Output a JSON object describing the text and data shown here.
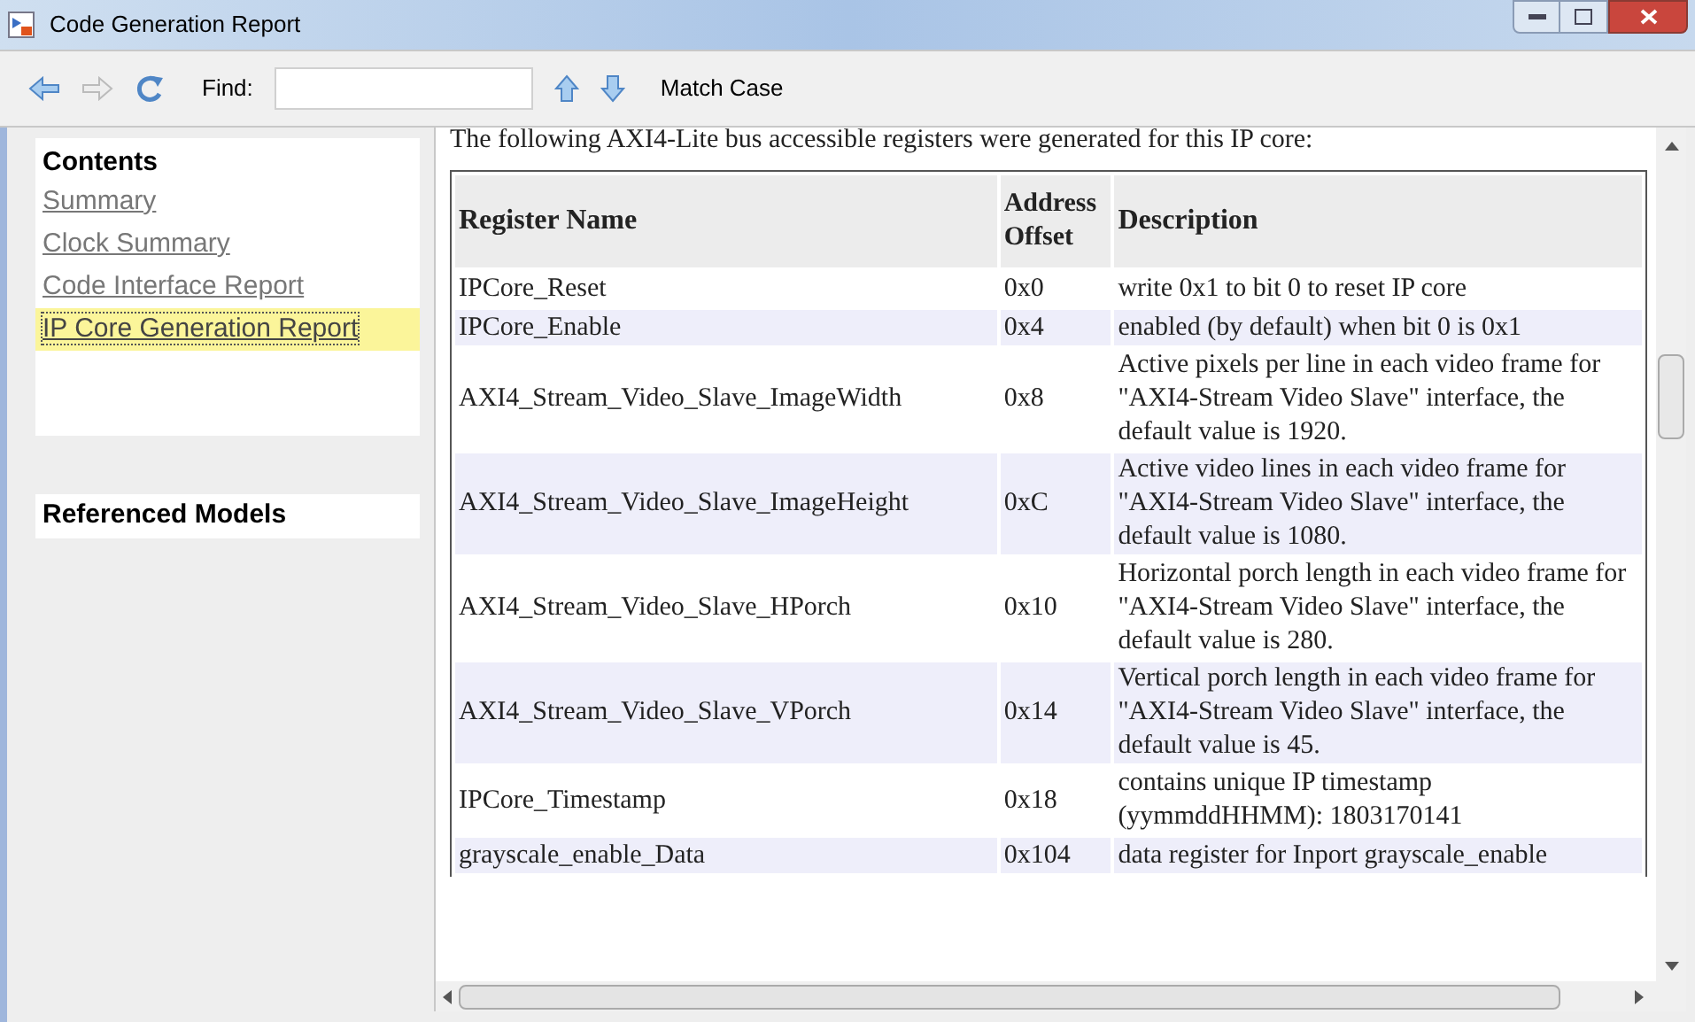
{
  "window": {
    "title": "Code Generation Report"
  },
  "toolbar": {
    "find_label": "Find:",
    "match_case": "Match Case"
  },
  "sidebar": {
    "contents_title": "Contents",
    "items": [
      {
        "label": "Summary",
        "selected": false
      },
      {
        "label": "Clock Summary",
        "selected": false
      },
      {
        "label": "Code Interface Report",
        "selected": false
      },
      {
        "label": "IP Core Generation Report",
        "selected": true
      }
    ],
    "referenced_title": "Referenced Models"
  },
  "report": {
    "intro": "The following AXI4-Lite bus accessible registers were generated for this IP core:",
    "table": {
      "columns": [
        "Register Name",
        "Address Offset",
        "Description"
      ],
      "rows": [
        [
          "IPCore_Reset",
          "0x0",
          "write 0x1 to bit 0 to reset IP core"
        ],
        [
          "IPCore_Enable",
          "0x4",
          "enabled (by default) when bit 0 is 0x1"
        ],
        [
          "AXI4_Stream_Video_Slave_ImageWidth",
          "0x8",
          "Active pixels per line in each video frame for \"AXI4-Stream Video Slave\" interface, the default value is 1920."
        ],
        [
          "AXI4_Stream_Video_Slave_ImageHeight",
          "0xC",
          "Active video lines in each video frame for \"AXI4-Stream Video Slave\" interface, the default value is 1080."
        ],
        [
          "AXI4_Stream_Video_Slave_HPorch",
          "0x10",
          "Horizontal porch length in each video frame for \"AXI4-Stream Video Slave\" interface, the default value is 280."
        ],
        [
          "AXI4_Stream_Video_Slave_VPorch",
          "0x14",
          "Vertical porch length in each video frame for \"AXI4-Stream Video Slave\" interface, the default value is 45."
        ],
        [
          "IPCore_Timestamp",
          "0x18",
          "contains unique IP timestamp (yymmddHHMM): 1803170141"
        ],
        [
          "grayscale_enable_Data",
          "0x104",
          "data register for Inport grayscale_enable"
        ]
      ]
    }
  }
}
